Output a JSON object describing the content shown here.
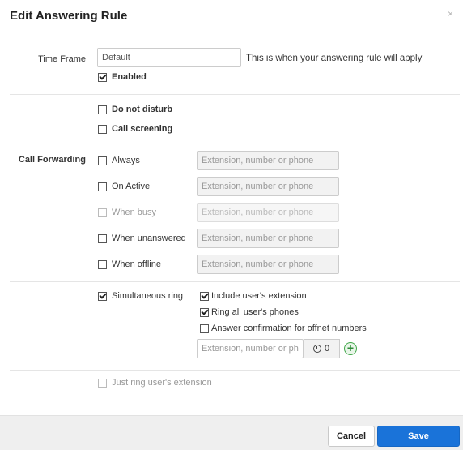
{
  "dialog": {
    "title": "Edit Answering Rule",
    "close_symbol": "×"
  },
  "time_frame": {
    "label": "Time Frame",
    "value": "Default",
    "hint": "This is when your answering rule will apply",
    "enabled_label": "Enabled",
    "enabled_checked": true
  },
  "options": {
    "dnd_label": "Do not disturb",
    "dnd_checked": false,
    "screening_label": "Call screening",
    "screening_checked": false
  },
  "call_forwarding": {
    "label": "Call Forwarding",
    "rows": [
      {
        "label": "Always",
        "checked": false,
        "disabled": false,
        "placeholder": "Extension, number or phone"
      },
      {
        "label": "On Active",
        "checked": false,
        "disabled": false,
        "placeholder": "Extension, number or phone"
      },
      {
        "label": "When busy",
        "checked": false,
        "disabled": true,
        "placeholder": "Extension, number or phone"
      },
      {
        "label": "When unanswered",
        "checked": false,
        "disabled": false,
        "placeholder": "Extension, number or phone"
      },
      {
        "label": "When offline",
        "checked": false,
        "disabled": false,
        "placeholder": "Extension, number or phone"
      }
    ]
  },
  "simultaneous": {
    "label": "Simultaneous ring",
    "checked": true,
    "include_ext_label": "Include user's extension",
    "include_ext_checked": true,
    "ring_all_label": "Ring all user's phones",
    "ring_all_checked": true,
    "answer_conf_label": "Answer confirmation for offnet numbers",
    "answer_conf_checked": false,
    "number_placeholder": "Extension, number or phone",
    "timer_value": "0"
  },
  "just_ring": {
    "label": "Just ring user's extension",
    "checked": false,
    "disabled": true
  },
  "footer": {
    "cancel_label": "Cancel",
    "save_label": "Save"
  },
  "colors": {
    "save_button": "#1a73d9",
    "add_icon": "#3fa648"
  }
}
